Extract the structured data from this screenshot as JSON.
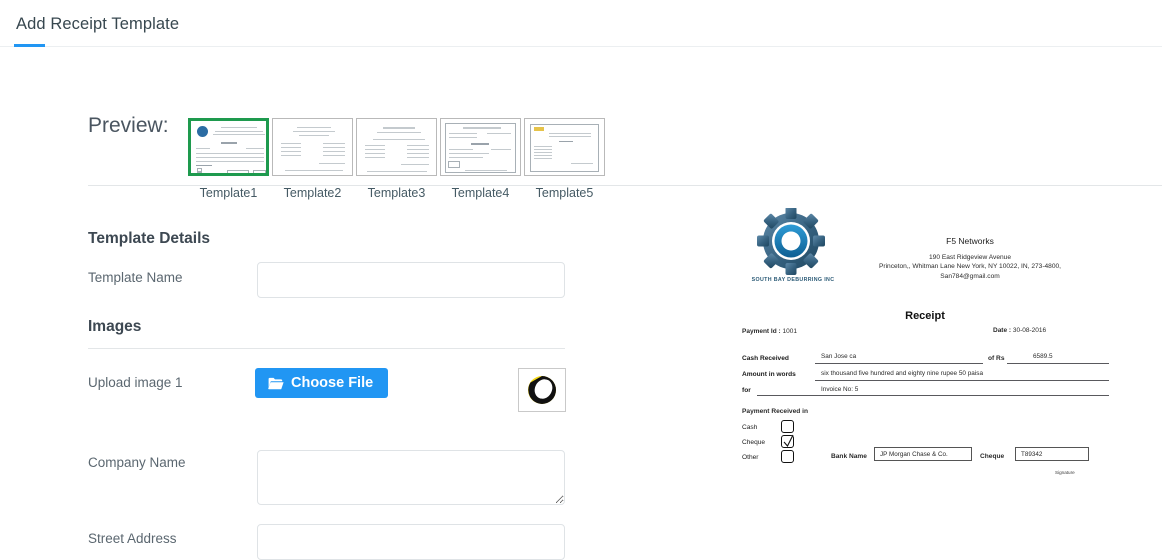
{
  "header": {
    "title": "Add Receipt Template",
    "accent_color": "#2196f3"
  },
  "preview": {
    "label": "Preview:",
    "selected_index": 0,
    "selected_border_color": "#1e9a4e",
    "templates": [
      {
        "name": "Template1"
      },
      {
        "name": "Template2"
      },
      {
        "name": "Template3"
      },
      {
        "name": "Template4"
      },
      {
        "name": "Template5"
      }
    ]
  },
  "form": {
    "template_details_heading": "Template Details",
    "template_name_label": "Template Name",
    "template_name_value": "",
    "template_name_placeholder": "",
    "images_heading": "Images",
    "upload_image_label": "Upload image 1",
    "choose_file_label": "Choose File",
    "choose_file_color": "#2196f3",
    "company_name_label": "Company Name",
    "company_name_value": "",
    "street_address_label": "Street Address",
    "street_address_value": ""
  },
  "receipt": {
    "logo_caption": "SOUTH BAY DEBURRING INC",
    "company_name": "F5 Networks",
    "address_line1": "190 East Ridgeview Avenue",
    "address_line2": "Princeton,, Whitman Lane New York, NY 10022, IN, 273-4800,",
    "address_line3": "San784@gmail.com",
    "title": "Receipt",
    "payment_id_label": "Payment Id :",
    "payment_id_value": "1001",
    "date_label": "Date :",
    "date_value": "30-08-2016",
    "cash_received_label": "Cash Received",
    "cash_received_value": "San Jose ca",
    "of_rs_label": "of Rs",
    "of_rs_value": "6589.5",
    "amount_words_label": "Amount in words",
    "amount_words_value": "six thousand five hundred and eighty nine  rupee 50  paisa",
    "for_label": "for",
    "for_value": "Invoice No: 5",
    "payment_received_in_label": "Payment Received in",
    "methods": [
      {
        "label": "Cash",
        "checked": false
      },
      {
        "label": "Cheque",
        "checked": true
      },
      {
        "label": "Other",
        "checked": false
      }
    ],
    "bank_name_label": "Bank Name",
    "bank_name_value": "JP Morgan Chase & Co.",
    "cheque_label": "Cheque",
    "cheque_value": "T89342",
    "signature_label": "Signature"
  }
}
